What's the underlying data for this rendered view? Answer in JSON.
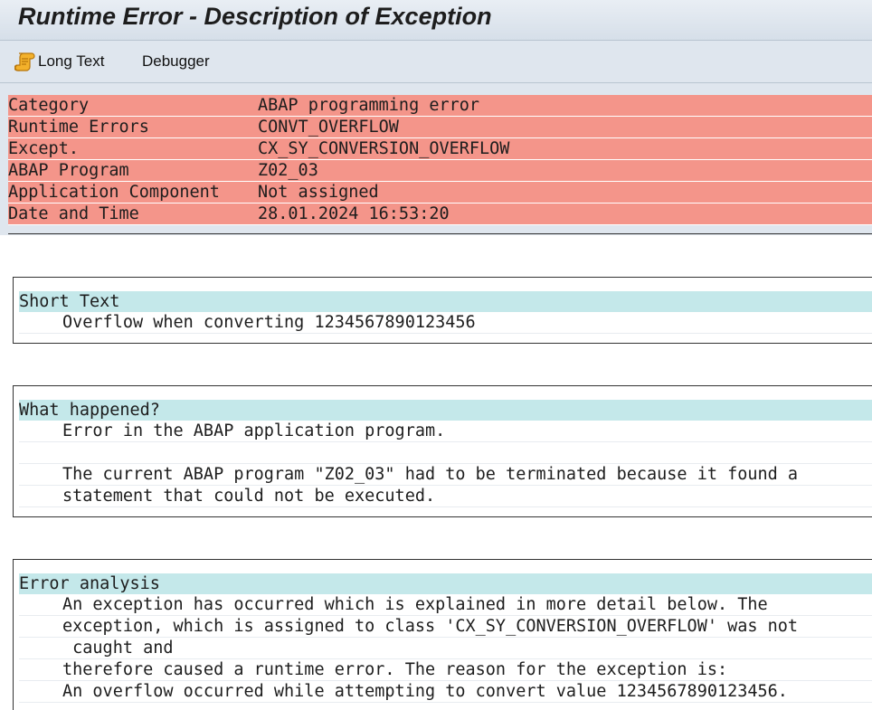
{
  "window": {
    "title": "Runtime Error - Description of Exception"
  },
  "toolbar": {
    "long_text_label": "Long Text",
    "debugger_label": "Debugger"
  },
  "header": {
    "rows": [
      {
        "key": "Category",
        "value": "ABAP programming error"
      },
      {
        "key": "Runtime Errors",
        "value": "CONVT_OVERFLOW"
      },
      {
        "key": "Except.",
        "value": "CX_SY_CONVERSION_OVERFLOW"
      },
      {
        "key": "ABAP Program",
        "value": "Z02_03"
      },
      {
        "key": "Application Component",
        "value": "Not assigned"
      },
      {
        "key": "Date and Time",
        "value": "28.01.2024 16:53:20"
      }
    ]
  },
  "sections": {
    "short_text": {
      "title": "Short Text",
      "lines": [
        "Overflow when converting 1234567890123456"
      ]
    },
    "what_happened": {
      "title": "What happened?",
      "lines": [
        "Error in the ABAP application program.",
        "",
        "The current ABAP program \"Z02_03\" had to be terminated because it found a",
        "statement that could not be executed."
      ]
    },
    "error_analysis": {
      "title": "Error analysis",
      "lines": [
        "An exception has occurred which is explained in more detail below. The",
        "exception, which is assigned to class 'CX_SY_CONVERSION_OVERFLOW' was not",
        " caught and",
        "therefore caused a runtime error. The reason for the exception is:",
        "An overflow occurred while attempting to convert value 1234567890123456."
      ]
    }
  },
  "colors": {
    "header_bg": "#f4958a",
    "section_head_bg": "#c4e8ea",
    "toolbar_bg": "#dfe6ee"
  },
  "icons": {
    "long_text": "scroll-icon"
  }
}
